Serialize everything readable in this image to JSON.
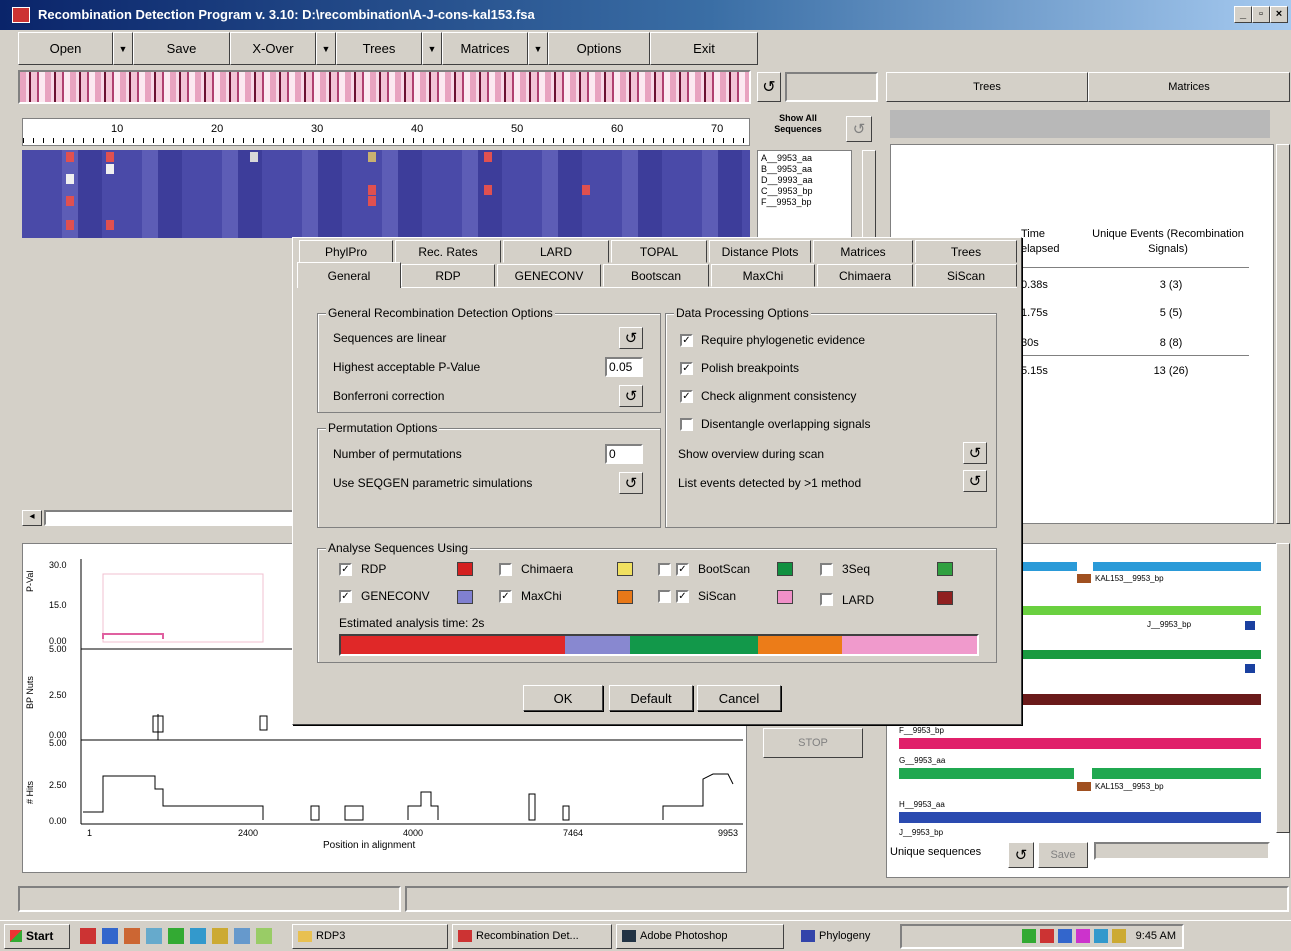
{
  "window": {
    "title": "Recombination Detection Program v. 3.10: D:\\recombination\\A-J-cons-kal153.fsa"
  },
  "toolbar": [
    {
      "label": "Open",
      "has_arrow": true
    },
    {
      "label": "Save",
      "has_arrow": false
    },
    {
      "label": "X-Over",
      "has_arrow": true
    },
    {
      "label": "Trees",
      "has_arrow": true
    },
    {
      "label": "Matrices",
      "has_arrow": true
    },
    {
      "label": "Options",
      "has_arrow": false
    },
    {
      "label": "Exit",
      "has_arrow": false
    }
  ],
  "ruler": {
    "ticks": [
      "10",
      "20",
      "30",
      "40",
      "50",
      "60",
      "70"
    ]
  },
  "show_all": "Show All Sequences",
  "sequences": [
    "A__9953_aa",
    "B__9953_aa",
    "D__9993_aa",
    "C__9953_bp",
    "F__9953_bp"
  ],
  "right_tabs": [
    "Trees",
    "Matrices"
  ],
  "results": {
    "headers": [
      "Time elapsed",
      "Unique Events (Recombination Signals)"
    ],
    "rows": [
      {
        "time": "0.38s",
        "events": "3 (3)"
      },
      {
        "time": "1.75s",
        "events": "5 (5)"
      },
      {
        "time": "30s",
        "events": "8 (8)"
      },
      {
        "time": "5.15s",
        "events": "13 (26)"
      }
    ]
  },
  "plots": {
    "y1_label": "P-Val",
    "y1_ticks": [
      "30.0",
      "15.0",
      "0.00"
    ],
    "y2_label": "BP Nuts",
    "y2_ticks": [
      "5.00",
      "2.50",
      "0.00"
    ],
    "y3_label": "# Hits",
    "y3_ticks": [
      "5.00",
      "2.50",
      "0.00"
    ],
    "x_ticks": [
      "1",
      "2400",
      "4000",
      "7464",
      "9953"
    ],
    "x_label": "Position in alignment"
  },
  "stop_button": "STOP",
  "mosaic": {
    "labels": [
      "KAL153__9953_bp",
      "J__9953_bp",
      "F__9953_bp",
      "G__9953_aa",
      "KAL153__9953_bp",
      "H__9953_aa",
      "J__9953_bp"
    ],
    "footer_label": "Unique sequences",
    "save_button": "Save"
  },
  "dialog": {
    "tabs_row1": [
      "PhylPro",
      "Rec. Rates",
      "LARD",
      "TOPAL",
      "Distance Plots",
      "Matrices",
      "Trees"
    ],
    "tabs_row2": [
      "General",
      "RDP",
      "GENECONV",
      "Bootscan",
      "MaxChi",
      "Chimaera",
      "SiScan"
    ],
    "general_group": {
      "title": "General Recombination Detection Options",
      "sequences_linear": "Sequences are linear",
      "highest_pvalue": "Highest acceptable P-Value",
      "pvalue": "0.05",
      "bonferroni": "Bonferroni correction"
    },
    "permutation_group": {
      "title": "Permutation Options",
      "num_perms": "Number of permutations",
      "num_perms_value": "0",
      "seqgen": "Use SEQGEN parametric simulations"
    },
    "data_group": {
      "title": "Data Processing Options",
      "options": [
        {
          "label": "Require phylogenetic evidence",
          "checked": true
        },
        {
          "label": "Polish breakpoints",
          "checked": true
        },
        {
          "label": "Check alignment consistency",
          "checked": true
        },
        {
          "label": "Disentangle overlapping signals",
          "checked": false
        }
      ],
      "show_overview": "Show overview during scan",
      "list_events": "List events detected by >1 method"
    },
    "analyse_group": {
      "title": "Analyse Sequences Using",
      "methods": [
        {
          "label": "RDP",
          "checked": true,
          "color": "#d42020"
        },
        {
          "label": "Chimaera",
          "checked": false,
          "color": "#f0e060"
        },
        {
          "label": "BootScan",
          "checked": true,
          "color": "#109040"
        },
        {
          "label": "3Seq",
          "checked": false,
          "color": "#30a040"
        },
        {
          "label": "GENECONV",
          "checked": true,
          "color": "#8080d0"
        },
        {
          "label": "MaxChi",
          "checked": true,
          "color": "#e87818"
        },
        {
          "label": "SiScan",
          "checked": true,
          "color": "#f090c8"
        },
        {
          "label": "LARD",
          "checked": false,
          "color": "#902020"
        }
      ],
      "estimated_time": "Estimated analysis time: 2s"
    },
    "buttons": [
      "OK",
      "Default",
      "Cancel"
    ]
  },
  "taskbar": {
    "start": "Start",
    "tasks": [
      "RDP3",
      "Recombination Det...",
      "Adobe Photoshop",
      "Phylogeny"
    ],
    "clock": "9:45 AM"
  }
}
